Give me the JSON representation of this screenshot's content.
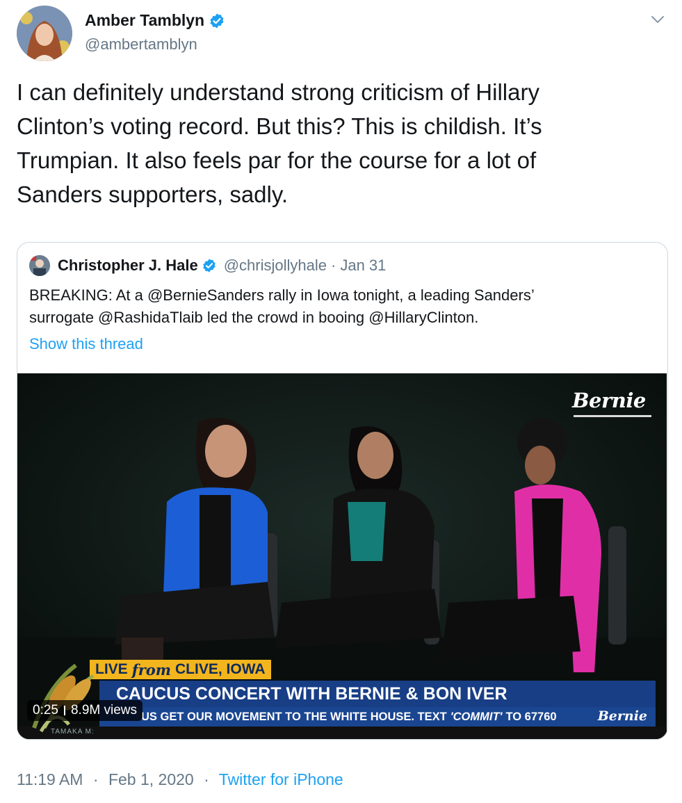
{
  "author": {
    "display_name": "Amber Tamblyn",
    "handle": "@ambertamblyn",
    "verified": true,
    "avatar_icon": "avatar-photo"
  },
  "tweet": {
    "text": "I can definitely understand strong criticism of Hillary\nClinton’s voting record. But this? This is childish. It’s\nTrumpian. It also feels par for the course for a lot of\nSanders supporters, sadly."
  },
  "quoted": {
    "display_name": "Christopher J. Hale",
    "handle": "@chrisjollyhale",
    "separator": "·",
    "date": "Jan 31",
    "text": "BREAKING: At a @BernieSanders rally in Iowa tonight, a leading Sanders’\nsurrogate @RashidaTlaib led the crowd in booing @HillaryClinton.",
    "show_thread": "Show this thread"
  },
  "video": {
    "logo": "Bernie",
    "live_label": "LIVE",
    "live_from": "from",
    "live_place": "CLIVE, IOWA",
    "headline": "CAUCUS CONCERT WITH BERNIE & BON IVER",
    "ticker_pre": "US GET OUR MOVEMENT TO THE WHITE HOUSE. TEXT",
    "ticker_commit": "'COMMIT'",
    "ticker_post": "TO 67760",
    "ticker_logo": "Bernie",
    "bottom_strip": "TAMAKA M:",
    "duration": "0:25",
    "views": "8.9M views"
  },
  "footer": {
    "time": "11:19 AM",
    "date": "Feb 1, 2020",
    "separator": "·",
    "source": "Twitter for iPhone"
  },
  "colors": {
    "link": "#1da1f2",
    "muted": "#657786",
    "verified": "#1da1f2",
    "border": "#ccd6dd"
  }
}
